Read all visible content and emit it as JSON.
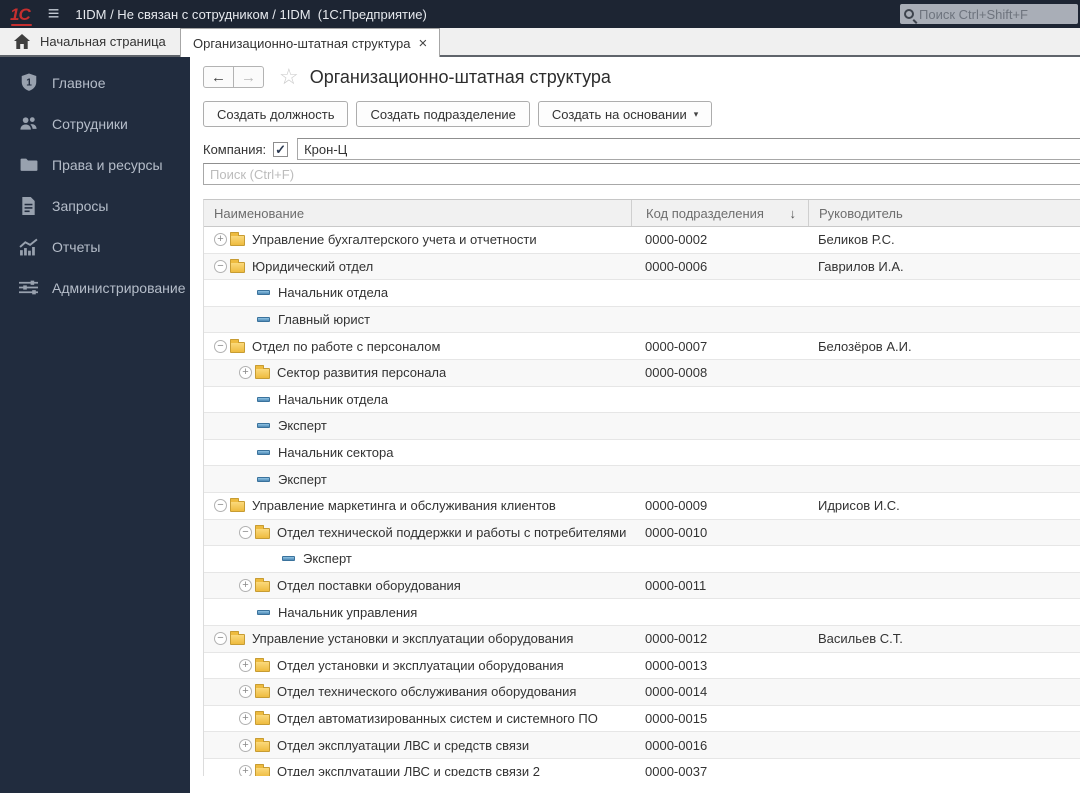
{
  "topbar": {
    "logo": "1С",
    "title": "1IDM / Не связан с сотрудником / 1IDM  (1С:Предприятие)",
    "search_placeholder": "Поиск Ctrl+Shift+F"
  },
  "tabs": {
    "home_label": "Начальная страница",
    "active_label": "Организационно-штатная структура",
    "close_glyph": "×"
  },
  "sidebar": {
    "items": [
      {
        "label": "Главное",
        "icon": "shield-1-icon"
      },
      {
        "label": "Сотрудники",
        "icon": "people-icon"
      },
      {
        "label": "Права и ресурсы",
        "icon": "folder-icon"
      },
      {
        "label": "Запросы",
        "icon": "document-icon"
      },
      {
        "label": "Отчеты",
        "icon": "chart-icon"
      },
      {
        "label": "Администрирование",
        "icon": "sliders-icon"
      }
    ]
  },
  "page": {
    "title": "Организационно-штатная структура",
    "back_glyph": "←",
    "forward_glyph": "→",
    "star_glyph": "☆"
  },
  "toolbar": {
    "create_position_label": "Создать должность",
    "create_department_label": "Создать подразделение",
    "create_based_on_label": "Создать на основании",
    "dropdown_caret": "▾"
  },
  "filter": {
    "company_label": "Компания:",
    "company_checked_glyph": "✓",
    "company_value": "Крон-Ц",
    "search_placeholder": "Поиск (Ctrl+F)"
  },
  "table": {
    "columns": [
      "Наименование",
      "Код подразделения",
      "Руководитель"
    ],
    "sort_glyph": "↓",
    "rows": [
      {
        "kind": "dept",
        "indent": 0,
        "exp": "plus",
        "name": "Управление бухгалтерского учета и отчетности",
        "code": "0000-0002",
        "manager": "Беликов Р.С."
      },
      {
        "kind": "dept",
        "indent": 0,
        "exp": "minus",
        "name": "Юридический отдел",
        "code": "0000-0006",
        "manager": "Гаврилов И.А."
      },
      {
        "kind": "pos",
        "indent": 1,
        "exp": null,
        "name": "Начальник отдела",
        "code": "",
        "manager": ""
      },
      {
        "kind": "pos",
        "indent": 1,
        "exp": null,
        "name": "Главный юрист",
        "code": "",
        "manager": ""
      },
      {
        "kind": "dept",
        "indent": 0,
        "exp": "minus",
        "name": "Отдел по работе с персоналом",
        "code": "0000-0007",
        "manager": "Белозёров А.И."
      },
      {
        "kind": "dept",
        "indent": 1,
        "exp": "plus",
        "name": "Сектор развития персонала",
        "code": "0000-0008",
        "manager": ""
      },
      {
        "kind": "pos",
        "indent": 1,
        "exp": null,
        "name": "Начальник отдела",
        "code": "",
        "manager": ""
      },
      {
        "kind": "pos",
        "indent": 1,
        "exp": null,
        "name": "Эксперт",
        "code": "",
        "manager": ""
      },
      {
        "kind": "pos",
        "indent": 1,
        "exp": null,
        "name": "Начальник сектора",
        "code": "",
        "manager": ""
      },
      {
        "kind": "pos",
        "indent": 1,
        "exp": null,
        "name": "Эксперт",
        "code": "",
        "manager": ""
      },
      {
        "kind": "dept",
        "indent": 0,
        "exp": "minus",
        "name": "Управление маркетинга и обслуживания клиентов",
        "code": "0000-0009",
        "manager": "Идрисов И.С."
      },
      {
        "kind": "dept",
        "indent": 1,
        "exp": "minus",
        "name": "Отдел технической поддержки и работы с потребителями",
        "code": "0000-0010",
        "manager": ""
      },
      {
        "kind": "pos",
        "indent": 2,
        "exp": null,
        "name": "Эксперт",
        "code": "",
        "manager": ""
      },
      {
        "kind": "dept",
        "indent": 1,
        "exp": "plus",
        "name": "Отдел поставки оборудования",
        "code": "0000-0011",
        "manager": ""
      },
      {
        "kind": "pos",
        "indent": 1,
        "exp": null,
        "name": "Начальник управления",
        "code": "",
        "manager": ""
      },
      {
        "kind": "dept",
        "indent": 0,
        "exp": "minus",
        "name": "Управление установки и эксплуатации оборудования",
        "code": "0000-0012",
        "manager": "Васильев С.Т."
      },
      {
        "kind": "dept",
        "indent": 1,
        "exp": "plus",
        "name": "Отдел установки и эксплуатации оборудования",
        "code": "0000-0013",
        "manager": ""
      },
      {
        "kind": "dept",
        "indent": 1,
        "exp": "plus",
        "name": "Отдел технического обслуживания оборудования",
        "code": "0000-0014",
        "manager": ""
      },
      {
        "kind": "dept",
        "indent": 1,
        "exp": "plus",
        "name": "Отдел автоматизированных систем и системного ПО",
        "code": "0000-0015",
        "manager": ""
      },
      {
        "kind": "dept",
        "indent": 1,
        "exp": "plus",
        "name": "Отдел эксплуатации ЛВС и средств связи",
        "code": "0000-0016",
        "manager": ""
      },
      {
        "kind": "dept",
        "indent": 1,
        "exp": "plus",
        "name": "Отдел эксплуатации ЛВС и средств связи 2",
        "code": "0000-0037",
        "manager": ""
      }
    ]
  },
  "colors": {
    "topbar_bg": "#1d2533",
    "sidebar_bg": "#212c3e",
    "accent_red": "#c62f2f",
    "folder_yellow": "#eebb3f",
    "position_blue": "#4e88b4",
    "tab_underline": "#5f646b"
  }
}
